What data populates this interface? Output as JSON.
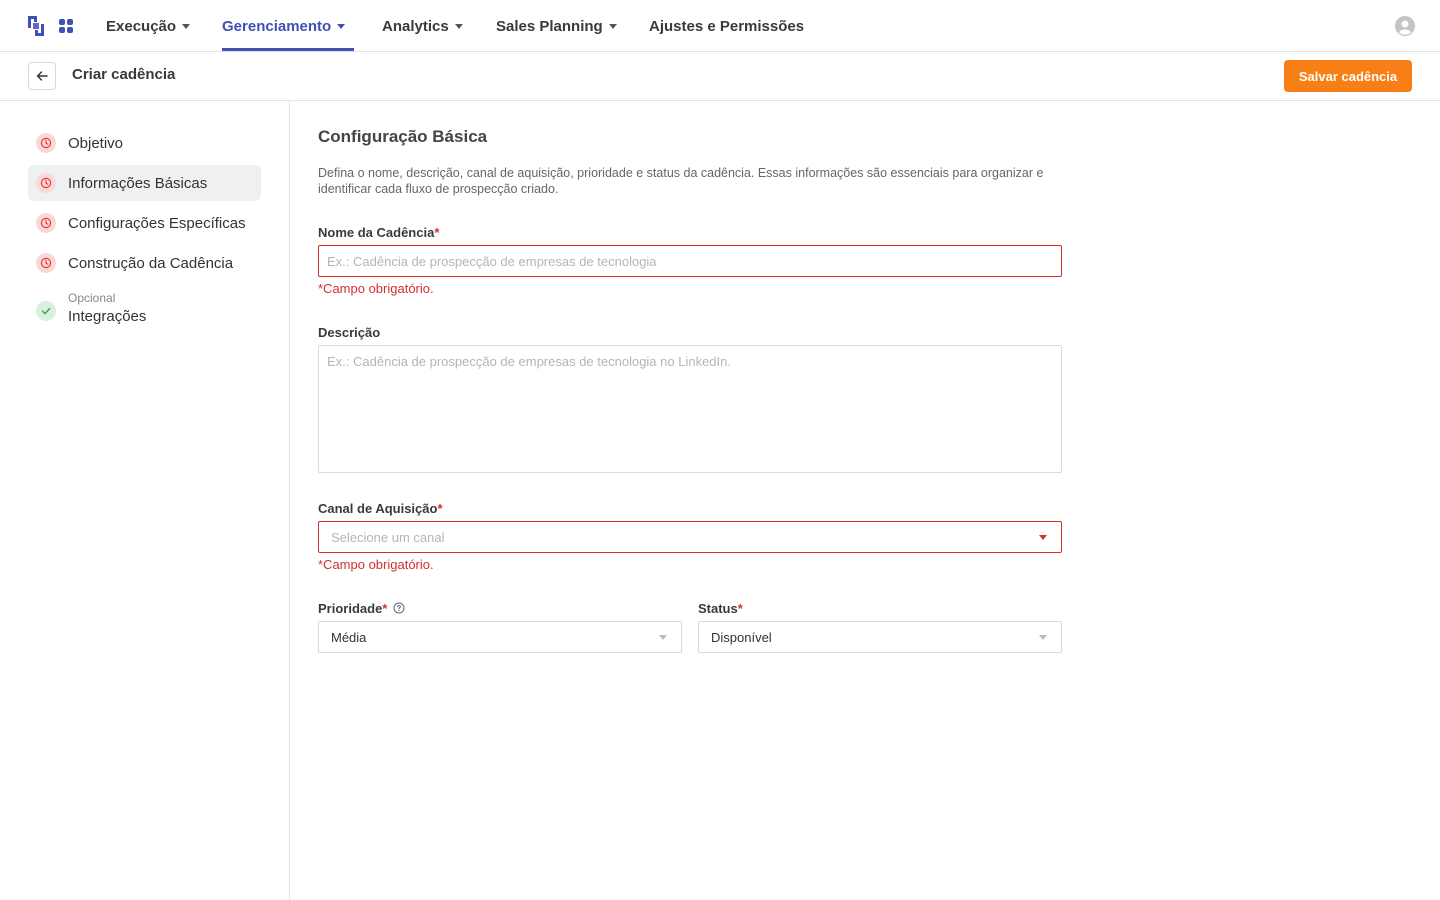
{
  "nav": {
    "items": [
      {
        "label": "Execução",
        "has_caret": true
      },
      {
        "label": "Gerenciamento",
        "has_caret": true,
        "active": true
      },
      {
        "label": "Analytics",
        "has_caret": true
      },
      {
        "label": "Sales Planning",
        "has_caret": true
      },
      {
        "label": "Ajustes e Permissões",
        "has_caret": false
      }
    ],
    "active_color": "#3f51b5",
    "icons": [
      "logo-icon",
      "apps-grid-icon",
      "user-avatar-icon"
    ]
  },
  "subheader": {
    "title": "Criar cadência",
    "save_label": "Salvar cadência",
    "save_color": "#f77f16",
    "back_icon": "arrow-left-icon"
  },
  "sidebar": {
    "steps": [
      {
        "label": "Objetivo",
        "status": "pending",
        "icon": "clock-icon"
      },
      {
        "label": "Informações Básicas",
        "status": "pending",
        "icon": "clock-icon",
        "active": true
      },
      {
        "label": "Configurações Específicas",
        "status": "pending",
        "icon": "clock-icon"
      },
      {
        "label": "Construção da Cadência",
        "status": "pending",
        "icon": "clock-icon"
      },
      {
        "label": "Integrações",
        "sublabel": "Opcional",
        "status": "done",
        "icon": "check-icon"
      }
    ]
  },
  "main": {
    "title": "Configuração Básica",
    "description": "Defina o nome, descrição, canal de aquisição, prioridade e status da cadência. Essas informações são essenciais para organizar e identificar cada fluxo de prospecção criado.",
    "name_field": {
      "label": "Nome da Cadência",
      "required_mark": "*",
      "placeholder": "Ex.: Cadência de prospecção de empresas de tecnologia",
      "value": "",
      "error": "*Campo obrigatório."
    },
    "description_field": {
      "label": "Descrição",
      "placeholder": "Ex.: Cadência de prospecção de empresas de tecnologia no LinkedIn.",
      "value": ""
    },
    "channel_field": {
      "label": "Canal de Aquisição",
      "required_mark": "*",
      "placeholder": "Selecione um canal",
      "error": "*Campo obrigatório."
    },
    "priority_field": {
      "label": "Prioridade",
      "required_mark": "*",
      "value": "Média",
      "help_icon": "question-circle-icon"
    },
    "status_field": {
      "label": "Status",
      "required_mark": "*",
      "value": "Disponível"
    },
    "error_color": "#d32f2f"
  }
}
